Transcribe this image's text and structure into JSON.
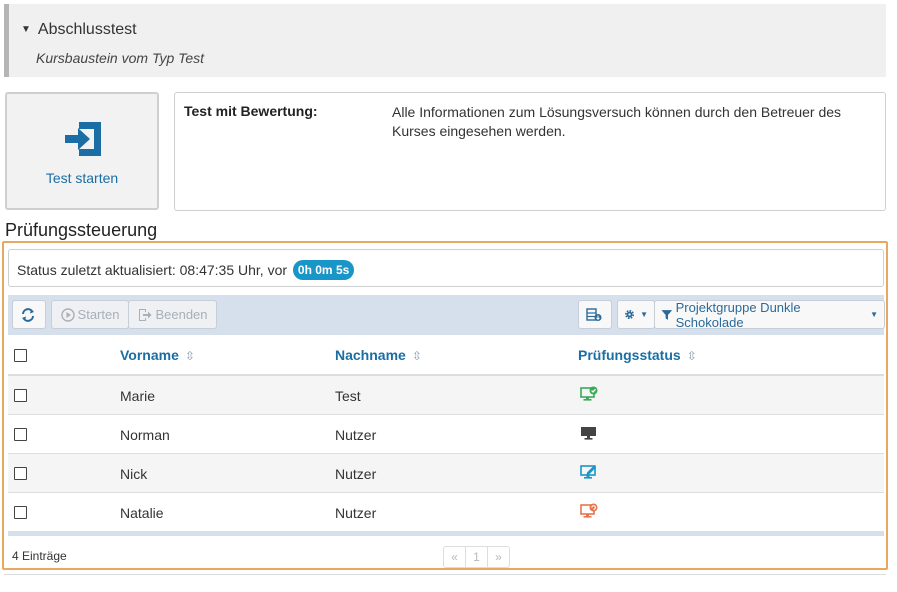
{
  "header": {
    "title": "Abschlusstest",
    "subtitle": "Kursbaustein vom Typ Test"
  },
  "start": {
    "label": "Test starten"
  },
  "info": {
    "key": "Test mit Bewertung:",
    "value": "Alle Informationen zum Lösungsversuch können durch den Betreuer des Kurses eingesehen werden."
  },
  "section": {
    "title": "Prüfungssteuerung"
  },
  "status": {
    "text": "Status zuletzt aktualisiert: 08:47:35 Uhr, vor",
    "badge": "0h 0m 5s"
  },
  "toolbar": {
    "start_label": "Starten",
    "end_label": "Beenden",
    "filter_label": "Projektgruppe Dunkle Schokolade"
  },
  "table": {
    "columns": {
      "first": "Vorname",
      "last": "Nachname",
      "status": "Prüfungsstatus"
    },
    "rows": [
      {
        "first": "Marie",
        "last": "Test",
        "status_icon": "monitor-check-icon",
        "color": "#3aaa5a"
      },
      {
        "first": "Norman",
        "last": "Nutzer",
        "status_icon": "monitor-icon",
        "color": "#444444"
      },
      {
        "first": "Nick",
        "last": "Nutzer",
        "status_icon": "monitor-edit-icon",
        "color": "#1a95c8"
      },
      {
        "first": "Natalie",
        "last": "Nutzer",
        "status_icon": "monitor-refresh-icon",
        "color": "#e8754a"
      }
    ]
  },
  "footer": {
    "count": "4 Einträge",
    "pager": {
      "prev": "«",
      "page": "1",
      "next": "»"
    }
  },
  "colors": {
    "accent": "#1a6ea5",
    "badge": "#1a95c8",
    "highlight": "#e8a860",
    "toolbar": "#d6e0ed"
  }
}
